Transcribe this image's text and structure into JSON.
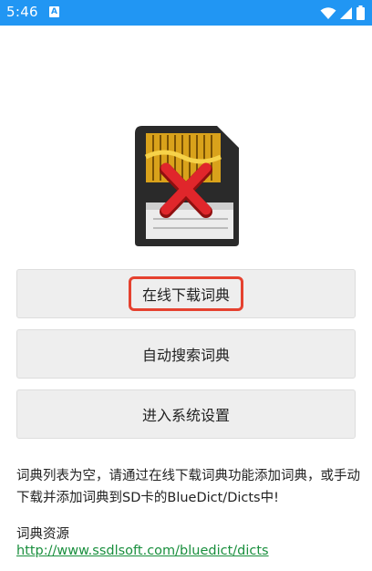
{
  "status_bar": {
    "time": "5:46",
    "notification_label": "A",
    "icons": [
      "wifi-icon",
      "signal-icon",
      "battery-icon"
    ]
  },
  "main": {
    "image": "sd-card-error-icon",
    "buttons": {
      "online_download": "在线下载词典",
      "auto_search": "自动搜索词典",
      "settings": "进入系统设置"
    },
    "info": "词典列表为空，请通过在线下载词典功能添加词典，或手动下载并添加词典到SD卡的BlueDict/Dicts中!",
    "resources_title": "词典资源",
    "resources_link": "http://www.ssdlsoft.com/bluedict/dicts"
  },
  "colors": {
    "status_bar": "#2196f3",
    "highlight": "#e5412f",
    "link": "#1a8f3e"
  }
}
